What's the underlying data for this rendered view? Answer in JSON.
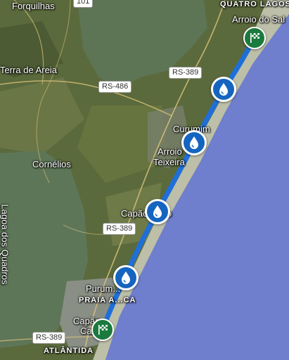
{
  "map": {
    "colors": {
      "ocean": "#6f7fce",
      "lagoon": "#5d7455",
      "land": "#5b6a3c",
      "beach": "#bdbfa8",
      "route": "#1e6fd9",
      "marker": "#1565c0",
      "flag": "#1b7a3e"
    },
    "labels": {
      "forquilhas": "Forquilhas",
      "terra_de_areia": "Terra de Areia",
      "cornelios": "Cornélios",
      "lagoa_dos_quadros": "Lagoa dos Quadros",
      "quatro_lagos": "QUATRO LAGOS",
      "arroio_do_sal": "Arroio do Sal",
      "curumim": "Curumim",
      "arroio": "Arroio",
      "teixeira": "Teixeira",
      "capao_novo": "Capão Novo",
      "pururuca": "Purum...",
      "praia": "PRAIA A...CA",
      "capao_canoa": "Capão",
      "canoa": "Ca",
      "atlantida": "ATLÂNTIDA"
    },
    "shields": {
      "rs389_top": "RS-389",
      "rs486": "RS-486",
      "rs389_mid": "RS-389",
      "rs389_bottom": "RS-389",
      "top_partial": "101"
    },
    "markers": {
      "icon": "water-drop-icon",
      "finish_icon": "checkered-flag-icon"
    }
  }
}
